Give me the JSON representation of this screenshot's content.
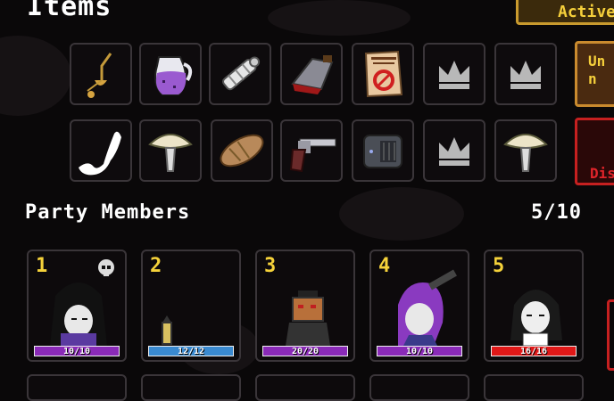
{
  "items_section": {
    "title": "Items",
    "slots": [
      {
        "icon": "scales-icon"
      },
      {
        "icon": "purple-jug-icon"
      },
      {
        "icon": "bandage-roll-icon"
      },
      {
        "icon": "bloody-cleaver-icon"
      },
      {
        "icon": "wanted-poster-icon"
      },
      {
        "icon": "empty-crown-slot-icon"
      },
      {
        "icon": "empty-crown-slot-icon"
      },
      {
        "icon": "ghost-wisp-icon"
      },
      {
        "icon": "mushroom-icon"
      },
      {
        "icon": "bread-loaf-icon"
      },
      {
        "icon": "revolver-icon"
      },
      {
        "icon": "radio-device-icon"
      },
      {
        "icon": "empty-crown-slot-icon"
      },
      {
        "icon": "mushroom-icon"
      }
    ]
  },
  "side_buttons": {
    "active_label": "Active",
    "unequip_label": "Un\nn",
    "discard_label": "\nDis"
  },
  "party": {
    "title": "Party Members",
    "count": "5/10",
    "members": [
      {
        "number": "1",
        "hp": "10/10",
        "bar_color": "#8a2ab8"
      },
      {
        "number": "2",
        "hp": "12/12",
        "bar_color": "#3a8ad0"
      },
      {
        "number": "3",
        "hp": "20/20",
        "bar_color": "#8a2ab8"
      },
      {
        "number": "4",
        "hp": "10/10",
        "bar_color": "#8a2ab8"
      },
      {
        "number": "5",
        "hp": "16/16",
        "bar_color": "#e01818"
      }
    ]
  }
}
